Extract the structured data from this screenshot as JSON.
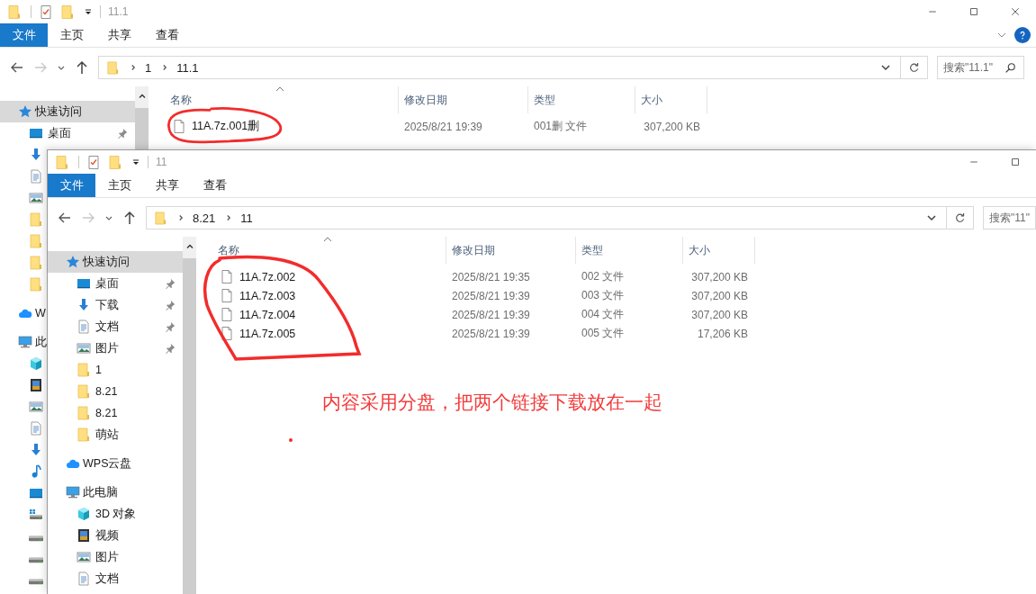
{
  "windows": [
    {
      "title": "11.1",
      "window_buttons": [
        {
          "kind": "minimize"
        },
        {
          "kind": "maximize"
        },
        {
          "kind": "close"
        }
      ],
      "ribbon_tabs": [
        {
          "label": "文件",
          "selected": true
        },
        {
          "label": "主页",
          "selected": false
        },
        {
          "label": "共享",
          "selected": false
        },
        {
          "label": "查看",
          "selected": false
        }
      ],
      "help": true,
      "path": [
        "1",
        "11.1"
      ],
      "search": {
        "placeholder": "搜索\"11.1\"",
        "icon": true
      },
      "sidebar": [
        {
          "kind": "star",
          "label": "快速访问",
          "selected": true,
          "children": [
            {
              "kind": "desktop",
              "label": "桌面",
              "pinned": true,
              "selected": false
            },
            {
              "kind": "download",
              "selected": false
            },
            {
              "kind": "document",
              "selected": false
            },
            {
              "kind": "picture",
              "selected": false
            },
            {
              "kind": "folder",
              "selected": false
            },
            {
              "kind": "folder",
              "selected": false
            },
            {
              "kind": "folder",
              "selected": false
            },
            {
              "kind": "folder",
              "selected": false
            }
          ]
        },
        {
          "kind": "cloud",
          "label": "W",
          "selected": false
        },
        {
          "kind": "pc",
          "label": "此",
          "selected": false,
          "children": [
            {
              "kind": "cube",
              "selected": false
            },
            {
              "kind": "video",
              "selected": false
            },
            {
              "kind": "picture",
              "selected": false
            },
            {
              "kind": "document",
              "selected": false
            },
            {
              "kind": "download",
              "selected": false
            },
            {
              "kind": "music",
              "selected": false
            },
            {
              "kind": "desktop",
              "selected": false
            },
            {
              "kind": "drive_win",
              "selected": false
            },
            {
              "kind": "drive",
              "selected": false
            },
            {
              "kind": "drive",
              "selected": false
            },
            {
              "kind": "drive",
              "selected": false
            }
          ]
        }
      ],
      "columns": [
        "名称",
        "修改日期",
        "类型",
        "大小"
      ],
      "files": [
        {
          "name": "11A.7z.001删",
          "date": "2025/8/21 19:39",
          "type": "001删 文件",
          "size": "307,200 KB"
        }
      ]
    },
    {
      "title": "11",
      "window_buttons": [
        {
          "kind": "minimize"
        },
        {
          "kind": "maximize"
        }
      ],
      "ribbon_tabs": [
        {
          "label": "文件",
          "selected": true
        },
        {
          "label": "主页",
          "selected": false
        },
        {
          "label": "共享",
          "selected": false
        },
        {
          "label": "查看",
          "selected": false
        }
      ],
      "path": [
        "8.21",
        "11"
      ],
      "search": {
        "placeholder": "搜索\"11\""
      },
      "sidebar": [
        {
          "kind": "star",
          "label": "快速访问",
          "selected": true,
          "children": [
            {
              "kind": "desktop",
              "label": "桌面",
              "pinned": true,
              "selected": false
            },
            {
              "kind": "download",
              "label": "下载",
              "pinned": true,
              "selected": false
            },
            {
              "kind": "document",
              "label": "文档",
              "pinned": true,
              "selected": false
            },
            {
              "kind": "picture",
              "label": "图片",
              "pinned": true,
              "selected": false
            },
            {
              "kind": "folder",
              "label": "1",
              "pinned": false,
              "selected": false
            },
            {
              "kind": "folder",
              "label": "8.21",
              "pinned": false,
              "selected": false
            },
            {
              "kind": "folder",
              "label": "8.21",
              "pinned": false,
              "selected": false
            },
            {
              "kind": "folder",
              "label": "萌站",
              "pinned": false,
              "selected": false
            }
          ]
        },
        {
          "kind": "cloud",
          "label": "WPS云盘",
          "selected": false
        },
        {
          "kind": "pc",
          "label": "此电脑",
          "selected": false,
          "children": [
            {
              "kind": "cube",
              "label": "3D 对象",
              "selected": false
            },
            {
              "kind": "video",
              "label": "视频",
              "selected": false
            },
            {
              "kind": "picture",
              "label": "图片",
              "selected": false
            },
            {
              "kind": "document",
              "label": "文档",
              "selected": false
            }
          ]
        }
      ],
      "columns": [
        "名称",
        "修改日期",
        "类型",
        "大小"
      ],
      "files": [
        {
          "name": "11A.7z.002",
          "date": "2025/8/21 19:35",
          "type": "002 文件",
          "size": "307,200 KB"
        },
        {
          "name": "11A.7z.003",
          "date": "2025/8/21 19:39",
          "type": "003 文件",
          "size": "307,200 KB"
        },
        {
          "name": "11A.7z.004",
          "date": "2025/8/21 19:39",
          "type": "004 文件",
          "size": "307,200 KB"
        },
        {
          "name": "11A.7z.005",
          "date": "2025/8/21 19:39",
          "type": "005 文件",
          "size": "17,206 KB"
        }
      ]
    }
  ],
  "annotation": {
    "text": "内容采用分盘，把两个链接下载放在一起"
  }
}
